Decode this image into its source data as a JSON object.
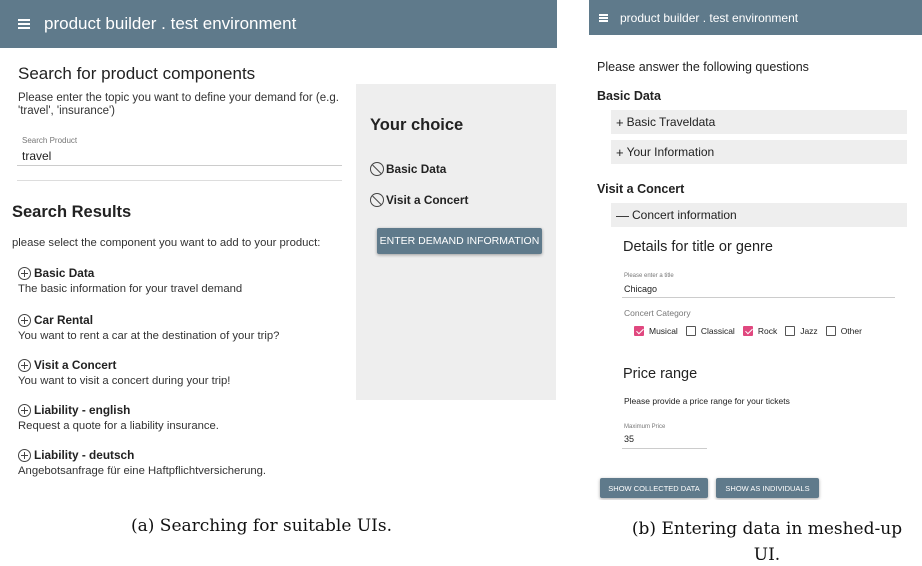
{
  "panel_a": {
    "app_title": "product builder . test environment",
    "search_title": "Search for product components",
    "search_description": "Please enter the topic you want to define your demand for (e.g. 'travel', 'insurance')",
    "search_field": {
      "label": "Search Product",
      "value": "travel"
    },
    "results_title": "Search Results",
    "results_description": "please select the component you want to add to your product:",
    "results": [
      {
        "title": "Basic Data",
        "description": "The basic information for your travel demand"
      },
      {
        "title": "Car Rental",
        "description": "You want to rent a car at the destination of your trip?"
      },
      {
        "title": "Visit a Concert",
        "description": "You want to visit a concert during your trip!"
      },
      {
        "title": "Liability - english",
        "description": "Request a quote for a liability insurance."
      },
      {
        "title": "Liability - deutsch",
        "description": "Angebotsanfrage für eine Haftpflichtversicherung."
      }
    ],
    "choice": {
      "title": "Your choice",
      "items": [
        "Basic Data",
        "Visit a Concert"
      ],
      "button_label": "ENTER DEMAND INFORMATION"
    },
    "caption": "(a) Searching for suitable UIs."
  },
  "panel_b": {
    "app_title": "product builder . test environment",
    "intro": "Please answer the following questions",
    "sections": [
      {
        "title": "Basic Data",
        "panels": [
          "Basic Traveldata",
          "Your Information"
        ]
      },
      {
        "title": "Visit a Concert",
        "panels": [
          "Concert information"
        ]
      }
    ],
    "expand_sign": "+",
    "collapse_sign": "—",
    "details_heading": "Details for title or genre",
    "title_field": {
      "label": "Please enter a title",
      "value": "Chicago"
    },
    "category_label": "Concert Category",
    "categories": [
      {
        "label": "Musical",
        "checked": true
      },
      {
        "label": "Classical",
        "checked": false
      },
      {
        "label": "Rock",
        "checked": true
      },
      {
        "label": "Jazz",
        "checked": false
      },
      {
        "label": "Other",
        "checked": false
      }
    ],
    "price_heading": "Price range",
    "price_description": "Please provide a price range for your tickets",
    "price_field": {
      "label": "Maximum Price",
      "value": "35"
    },
    "buttons": [
      "SHOW COLLECTED DATA",
      "SHOW AS INDIVIDUALS"
    ],
    "caption_line1": "(b) Entering data in meshed-up",
    "caption_line2": "UI."
  },
  "colors": {
    "appbar": "#5f7a8b",
    "panel_bg": "#eeeeee",
    "checkbox_on": "#e0487f"
  },
  "icons": [
    "menu-icon",
    "add-circle-icon",
    "block-icon",
    "checkbox-icon"
  ]
}
